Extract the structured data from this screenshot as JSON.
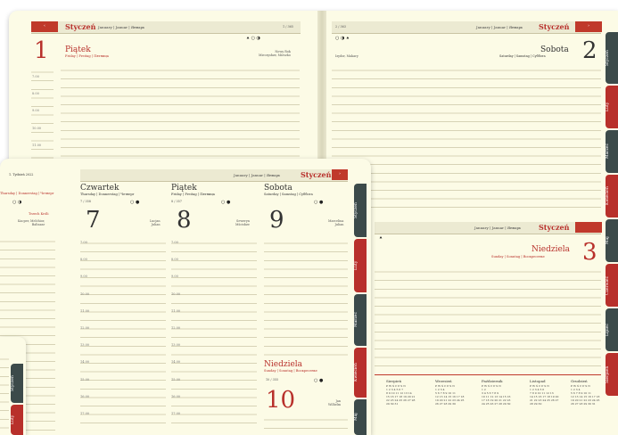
{
  "top_spread": {
    "left_page": {
      "header_arrow": "‹",
      "month": "Styczeń",
      "month_langs": "January | Januar | Январь",
      "week_label": "1 / 365",
      "day_number": "1",
      "day_name": "Piątek",
      "day_sub": "Friday | Freitag | Пятница",
      "names": "Nowy Rok\nMieczysław, Mieszko",
      "hours": [
        "7.00",
        "8.00",
        "9.00",
        "10.00",
        "11.00",
        "12.00"
      ]
    },
    "right_page": {
      "week_label": "2 / 363",
      "month_langs": "January | Januar | Январь",
      "month": "Styczeń",
      "header_arrow": "›",
      "day_number": "2",
      "day_name": "Sobota",
      "day_sub": "Saturday | Samstag | Субботa",
      "names": "Izydor, Makary",
      "sunday_month_langs": "January | Januar | Январь",
      "sunday_month": "Styczeń",
      "sunday_day_name": "Niedziela",
      "sunday_sub": "Sunday | Sonntag | Воскресенье",
      "sunday_number": "3",
      "months": [
        {
          "name": "Sierpień",
          "rows": [
            "P W Ś C P S N",
            "1 2 3 4 5 6 7",
            "8 9 10 11 12 13 14",
            "15 16 17 18 19 20 21",
            "22 23 24 25 26 27 28",
            "29 30 31"
          ]
        },
        {
          "name": "Wrzesień",
          "rows": [
            "P W Ś C P S N",
            "1 2 3 4",
            "5 6 7 8 9 10 11",
            "12 13 14 15 16 17 18",
            "19 20 21 22 23 24 25",
            "26 27 28 29 30"
          ]
        },
        {
          "name": "Październik",
          "rows": [
            "P W Ś C P S N",
            "1 2",
            "3 4 5 6 7 8 9",
            "10 11 12 13 14 15 16",
            "17 18 19 20 21 22 23",
            "24 25 26 27 28 29 30"
          ]
        },
        {
          "name": "Listopad",
          "rows": [
            "P W Ś C P S N",
            "1 2 3 4 5 6",
            "7 8 9 10 11 12 13",
            "14 15 16 17 18 19 20",
            "21 22 23 24 25 26 27",
            "28 29 30"
          ]
        },
        {
          "name": "Grudzień",
          "rows": [
            "P W Ś C P S N",
            "1 2 3 4",
            "5 6 7 8 9 10 11",
            "12 13 14 15 16 17 18",
            "19 20 21 22 23 24 25",
            "26 27 28 29 30 31"
          ]
        }
      ],
      "tabs": [
        "Styczeń",
        "Luty",
        "Marzec",
        "Kwiecień",
        "Maj",
        "Czerwiec",
        "Lipiec",
        "Sierpień"
      ]
    }
  },
  "middle_spread": {
    "left_fragment": {
      "week_label": "1. Tydzień 2022",
      "sub": "Thursday | Donnerstag | Четверг",
      "names": "Kacper, Melchior,\nBaltazar",
      "names2": "Trzech Króli"
    },
    "header_langs": "January | Januar | Январь",
    "month": "Styczeń",
    "days": [
      {
        "name": "Czwartek",
        "sub": "Thursday | Donnerstag | Четверг",
        "num": "7",
        "names": "Lucjan\nJulian",
        "week": "7 / 358"
      },
      {
        "name": "Piątek",
        "sub": "Friday | Freitag | Пятница",
        "num": "8",
        "names": "Seweryn\nMścisław",
        "week": "8 / 357"
      },
      {
        "name": "Sobota",
        "sub": "Saturday | Samstag | Субботa",
        "num": "9",
        "names": "Marcelina\nJulian",
        "week": ""
      }
    ],
    "sunday": {
      "name": "Niedziela",
      "sub": "Sunday | Sonntag | Воскресенье",
      "num": "10",
      "names": "Jan\nWilhelm",
      "week": "10 / 355"
    },
    "hours": [
      "7.00",
      "8.00",
      "9.00",
      "10.00",
      "11.00",
      "12.00",
      "13.00",
      "14.00",
      "15.00",
      "16.00",
      "17.00",
      "18.00"
    ],
    "tabs": [
      "Styczeń",
      "Luty",
      "Marzec",
      "Kwiecień",
      "Maj"
    ]
  },
  "bottom_fragment": {
    "tabs": [
      "Styczeń",
      "Luty"
    ]
  },
  "colors": {
    "accent": "#b8302b",
    "tab_dark": "#3c4a4a",
    "paper": "#fcfbe6"
  }
}
